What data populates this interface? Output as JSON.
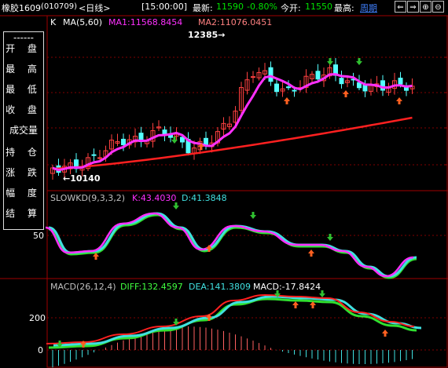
{
  "header": {
    "symbol": "橡胶1609",
    "code": "(010709)",
    "period": "<日线>",
    "time": "[15:00:00]",
    "latest_label": "最新:",
    "latest_value": "11590",
    "change_pct": "-0.80%",
    "open_label": "今开:",
    "open_value": "11550",
    "high_label": "最高:",
    "cycle_label": "周期",
    "nav_buttons": [
      "⇐",
      "⇒",
      "⊕",
      "⊖"
    ]
  },
  "side_menu": {
    "separator": "------",
    "items": [
      "开 盘",
      "最 高",
      "最 低",
      "收 盘",
      "成交量",
      "持 仓",
      "涨 跌",
      "幅 度",
      "结 算"
    ]
  },
  "main_panel": {
    "k_label": "K",
    "ma_label": "MA(5,60)",
    "ma1_label": "MA1:11568.8454",
    "ma2_label": "MA2:11076.0451",
    "peak_label": "12385→",
    "low_label": "←10140"
  },
  "kd_panel": {
    "title": "SLOWKD(9,3,3,2)",
    "k_value": "K:43.4030",
    "d_value": "D:41.3848",
    "axis_label": "50"
  },
  "macd_panel": {
    "title": "MACD(26,12,4)",
    "diff": "DIFF:132.4597",
    "dea": "DEA:141.3809",
    "macd": "MACD:-17.8424",
    "axis_labels": [
      "200",
      "0"
    ]
  },
  "colors": {
    "up": "#ff4040",
    "down": "#54ffff",
    "ma1": "#ff30ff",
    "ma2": "#ff2020",
    "k_line": "#ff30ff",
    "d_line": "#40e0e0",
    "grid": "#800000",
    "buy_arrow": "#ff6020",
    "sell_arrow": "#30c030"
  }
}
